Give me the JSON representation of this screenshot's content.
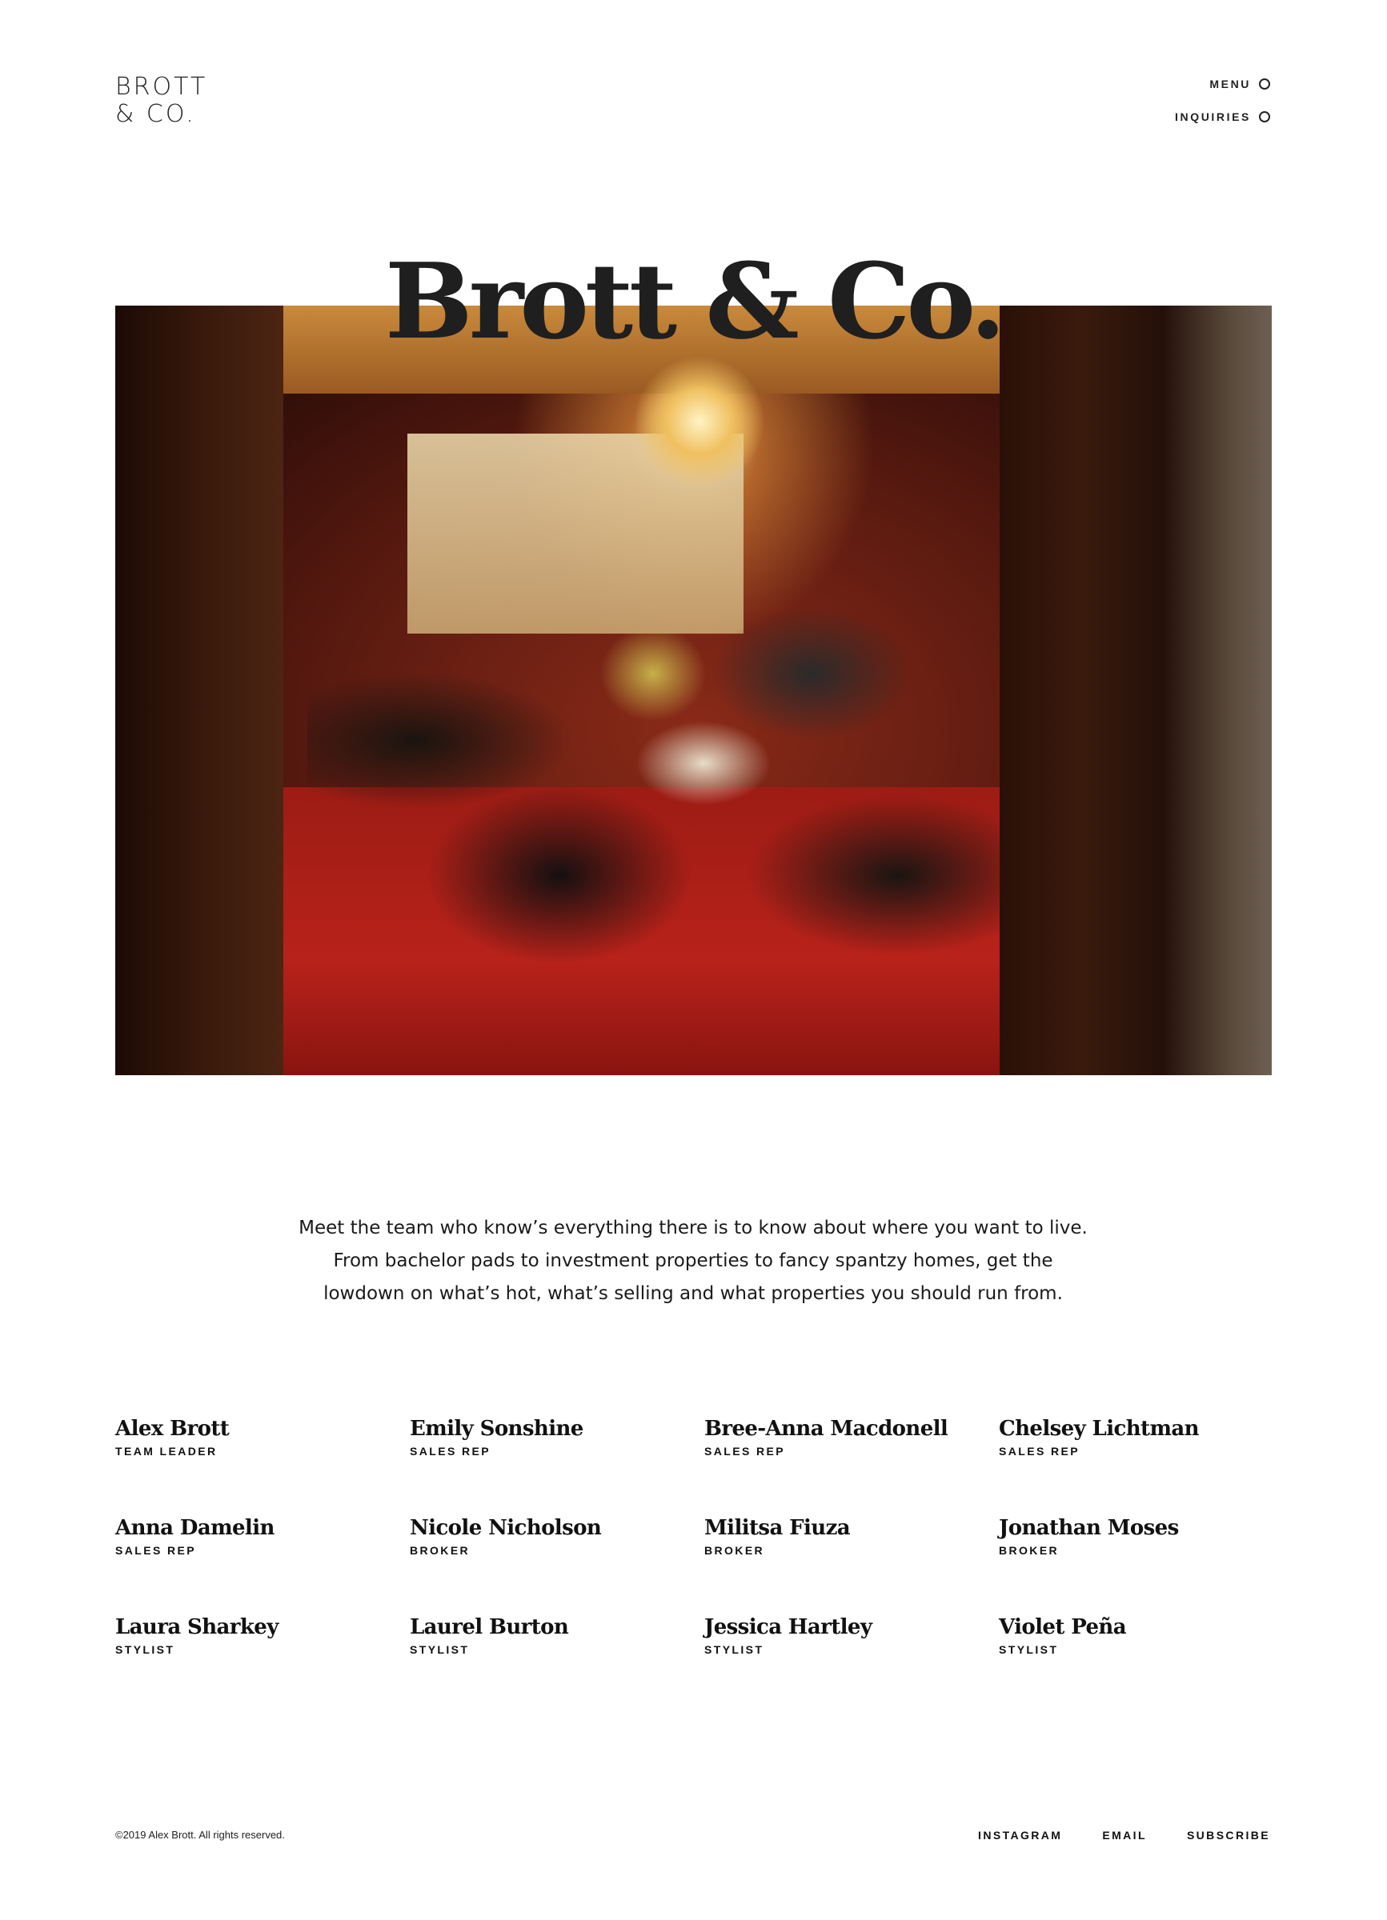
{
  "header": {
    "logo_line1": "BROTT",
    "logo_line2": "& CO.",
    "nav": {
      "menu_label": "MENU",
      "inquiries_label": "INQUIRIES"
    }
  },
  "hero": {
    "title": "Brott & Co."
  },
  "intro": {
    "line1": "Meet the team who know’s everything there is to know about where you want to live.",
    "line2": "From bachelor pads to investment properties to fancy spantzy homes, get the",
    "line3": "lowdown on what’s hot, what’s selling and what properties you should run from."
  },
  "team": [
    {
      "name": "Alex Brott",
      "role": "TEAM LEADER"
    },
    {
      "name": "Emily Sonshine",
      "role": "SALES REP"
    },
    {
      "name": "Bree-Anna Macdonell",
      "role": "SALES REP"
    },
    {
      "name": "Chelsey Lichtman",
      "role": "SALES REP"
    },
    {
      "name": "Anna Damelin",
      "role": "SALES REP"
    },
    {
      "name": "Nicole Nicholson",
      "role": "BROKER"
    },
    {
      "name": "Militsa Fiuza",
      "role": "BROKER"
    },
    {
      "name": "Jonathan Moses",
      "role": "BROKER"
    },
    {
      "name": "Laura Sharkey",
      "role": "STYLIST"
    },
    {
      "name": "Laurel Burton",
      "role": "STYLIST"
    },
    {
      "name": "Jessica Hartley",
      "role": "STYLIST"
    },
    {
      "name": "Violet Peña",
      "role": "STYLIST"
    }
  ],
  "footer": {
    "copyright": "©2019 Alex Brott. All rights reserved.",
    "links": [
      "INSTAGRAM",
      "EMAIL",
      "SUBSCRIBE"
    ]
  }
}
